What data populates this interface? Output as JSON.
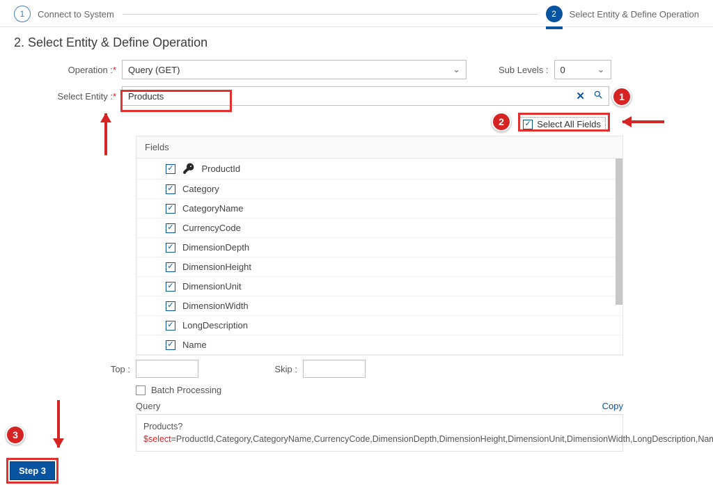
{
  "stepper": {
    "step1": {
      "num": "1",
      "label": "Connect to System"
    },
    "step2": {
      "num": "2",
      "label": "Select Entity & Define Operation"
    }
  },
  "section_title": "2. Select Entity & Define Operation",
  "labels": {
    "operation": "Operation :",
    "select_entity": "Select Entity :",
    "sub_levels": "Sub Levels :",
    "top": "Top :",
    "skip": "Skip :",
    "batch": "Batch Processing",
    "query": "Query",
    "copy": "Copy",
    "select_all": "Select All Fields",
    "fields_header": "Fields"
  },
  "operation_value": "Query (GET)",
  "sub_levels_value": "0",
  "entity_value": "Products",
  "fields": [
    {
      "name": "ProductId",
      "key": true
    },
    {
      "name": "Category",
      "key": false
    },
    {
      "name": "CategoryName",
      "key": false
    },
    {
      "name": "CurrencyCode",
      "key": false
    },
    {
      "name": "DimensionDepth",
      "key": false
    },
    {
      "name": "DimensionHeight",
      "key": false
    },
    {
      "name": "DimensionUnit",
      "key": false
    },
    {
      "name": "DimensionWidth",
      "key": false
    },
    {
      "name": "LongDescription",
      "key": false
    },
    {
      "name": "Name",
      "key": false
    }
  ],
  "query_prefix": "Products?",
  "query_select_kw": "$select",
  "query_rest": "=ProductId,Category,CategoryName,CurrencyCode,DimensionDepth,DimensionHeight,DimensionUnit,DimensionWidth,LongDescription,Name,PictureUrl,Price,QuantityUnit,ShortDescription,SupplierId,Weight,WeightUnit",
  "annotations": {
    "b1": "1",
    "b2": "2",
    "b3": "3"
  },
  "step3_label": "Step 3"
}
